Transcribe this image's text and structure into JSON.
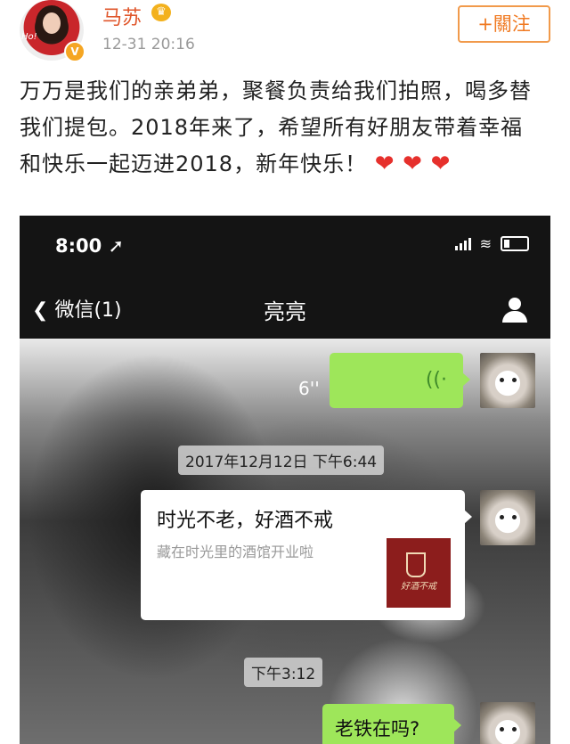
{
  "post": {
    "username": "马苏",
    "crown_icon": "crown-icon",
    "verified_badge": "V",
    "timestamp": "12-31 20:16",
    "follow_label": "+關注",
    "avatar_text": "Ho!",
    "text": "万万是我们的亲弟弟，聚餐负责给我们拍照，喝多替我们提包。2018年来了，希望所有好朋友带着幸福和快乐一起迈进2018，新年快乐！",
    "hearts": [
      "❤",
      "❤",
      "❤"
    ],
    "colors": {
      "username": "#e0562b",
      "follow": "#f07a22",
      "heart": "#e6302c"
    }
  },
  "phone": {
    "status_time": "8:00",
    "location_arrow": "➚",
    "wifi_icon": "wifi-icon",
    "nav_back_label": "微信(1)",
    "nav_title": "亮亮",
    "messages": {
      "voice_duration": "6''",
      "voice_icon": "((·",
      "timestamp_1": "2017年12月12日 下午6:44",
      "card_title": "时光不老，好酒不戒",
      "card_description": "藏在时光里的酒馆开业啦",
      "card_thumb_text": "好酒不戒",
      "timestamp_2": "下午3:12",
      "text_message": "老铁在吗?"
    },
    "colors": {
      "bubble": "#9ee65a",
      "bar": "#141414"
    }
  }
}
